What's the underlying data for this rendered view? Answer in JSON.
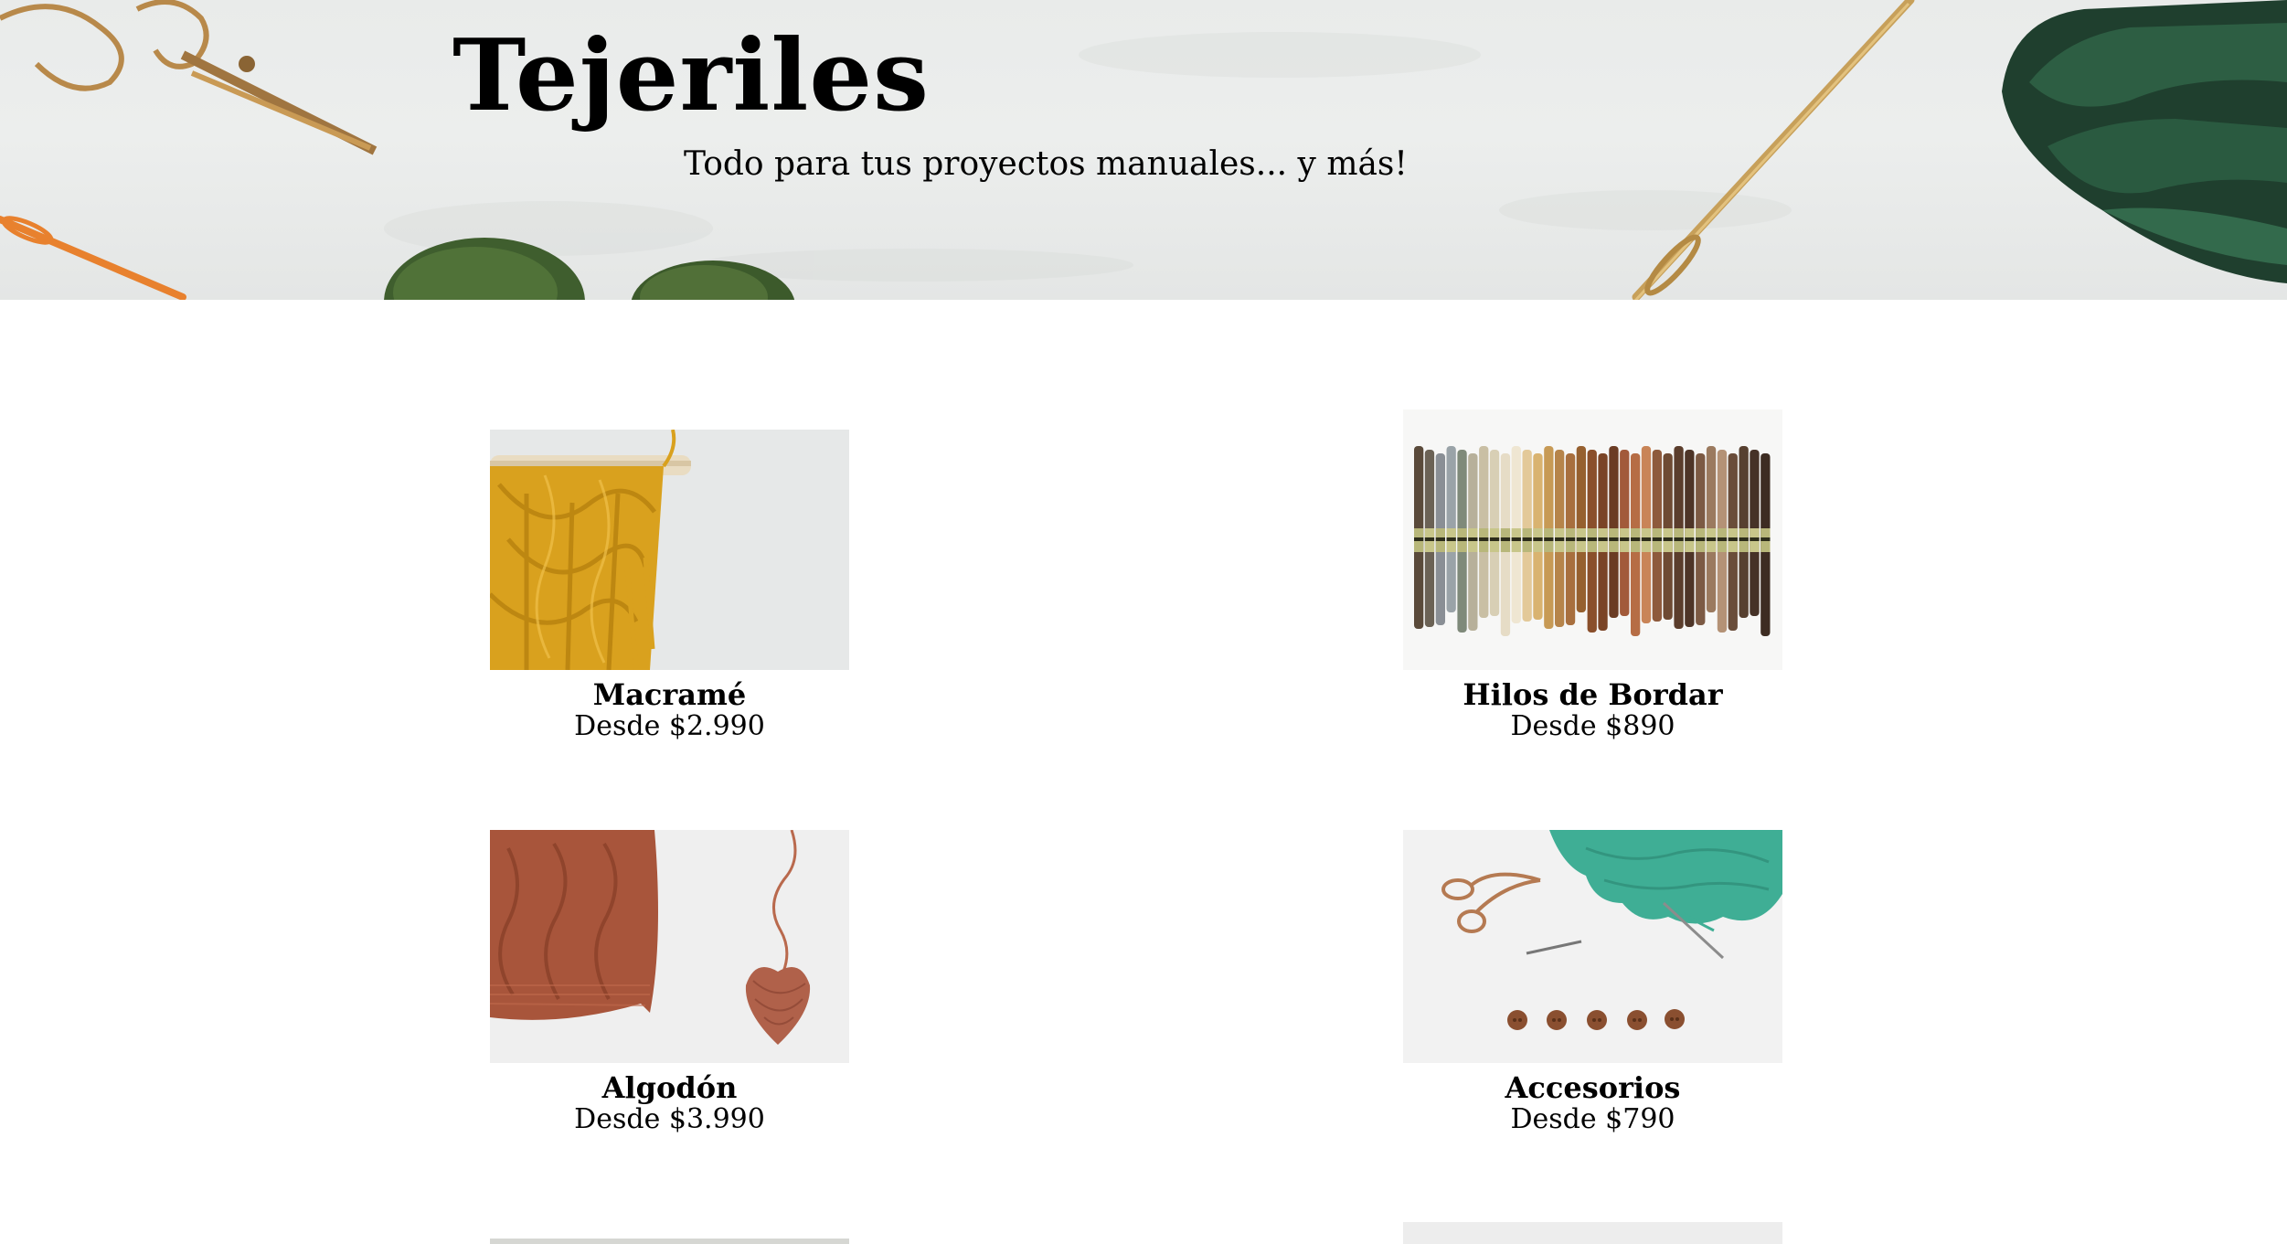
{
  "header": {
    "title": "Tejeriles",
    "tagline": "Todo para tus proyectos manuales... y más!"
  },
  "products": [
    {
      "name": "Macramé",
      "price": "Desde $2.990",
      "image": "macrame-photo"
    },
    {
      "name": "Hilos de Bordar",
      "price": "Desde $890",
      "image": "embroidery-threads-photo"
    },
    {
      "name": "Algodón",
      "price": "Desde $3.990",
      "image": "cotton-knit-photo"
    },
    {
      "name": "Accesorios",
      "price": "Desde $790",
      "image": "accessories-photo"
    }
  ],
  "colors": {
    "banner_background": "#eceeed",
    "text": "#000000",
    "page_background": "#ffffff",
    "macrame_yarn": "#d9a11e",
    "cotton_yarn": "#a8553b",
    "accessory_yarn": "#3fae95"
  }
}
